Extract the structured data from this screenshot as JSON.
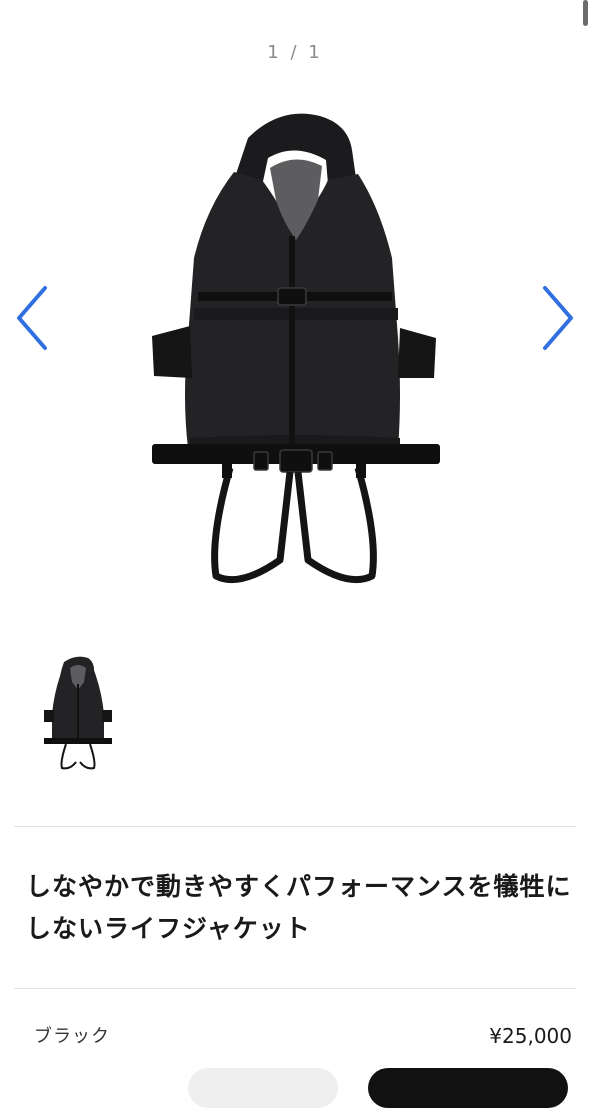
{
  "gallery": {
    "counter": "1 / 1",
    "prev_icon": "chevron-left-icon",
    "next_icon": "chevron-right-icon",
    "accent_color": "#2f6fe0"
  },
  "product": {
    "title": "しなやかで動きやすくパフォーマンスを犠牲にしないライフジャケット",
    "variant_name": "ブラック",
    "price": "¥25,000"
  }
}
